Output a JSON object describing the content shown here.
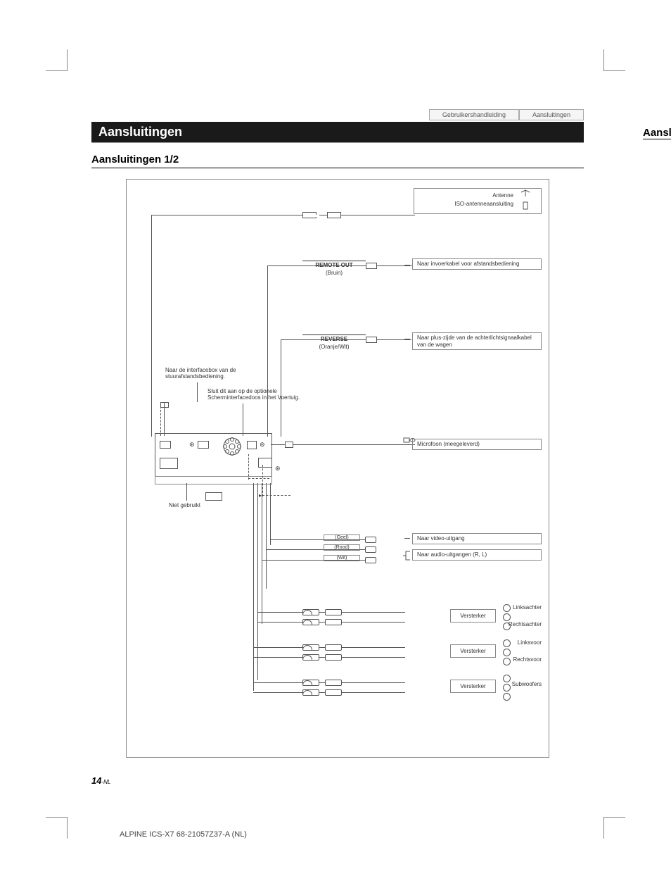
{
  "header": {
    "tabs": [
      "Gebruikershandleiding",
      "Aansluitingen"
    ]
  },
  "title": "Aansluitingen",
  "subtitle": "Aansluitingen 1/2",
  "side_title": "Aanslu",
  "diagram": {
    "antenna": {
      "label": "Antenne",
      "iso_label": "ISO-antenneaansluiting"
    },
    "remote_out": {
      "title": "REMOTE OUT",
      "color": "(Bruin)",
      "desc": "Naar invoerkabel voor afstandsbediening"
    },
    "reverse": {
      "title": "REVERSE",
      "color": "(Oranje/Wit)",
      "desc": "Naar plus-zijde van de achterlichtsignaalkabel van de wagen"
    },
    "steering_note1": "Naar de interfacebox van de stuurafstandsbediening.",
    "steering_note2": "Sluit dit aan op de optionele Scherminterfacedoos in het Voertuig.",
    "microphone": "Microfoon (meegeleverd)",
    "not_used": "Niet gebruikt",
    "av_in": {
      "yellow": "(Geel)",
      "red": "(Rood)",
      "white": "(Wit)",
      "video_out": "Naar video-uitgang",
      "audio_out": "Naar audio-uitgangen (R, L)"
    },
    "amps": {
      "label": "Versterker"
    },
    "speakers": {
      "rear_l": "Linksachter",
      "rear_r": "Rechtsachter",
      "front_l": "Linksvoor",
      "front_r": "Rechtsvoor",
      "sub": "Subwoofers"
    }
  },
  "page_number": "14",
  "page_suffix": "-NL",
  "footer": "ALPINE ICS-X7 68-21057Z37-A (NL)"
}
